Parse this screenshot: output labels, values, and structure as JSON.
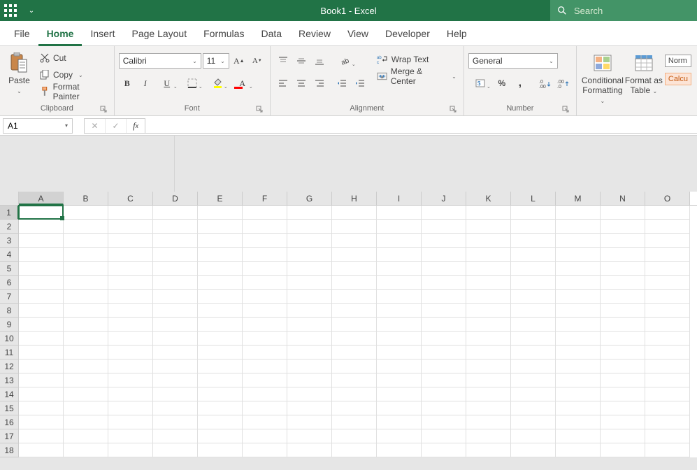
{
  "title": "Book1  -  Excel",
  "search_placeholder": "Search",
  "tabs": [
    "File",
    "Home",
    "Insert",
    "Page Layout",
    "Formulas",
    "Data",
    "Review",
    "View",
    "Developer",
    "Help"
  ],
  "active_tab": "Home",
  "clipboard": {
    "paste": "Paste",
    "cut": "Cut",
    "copy": "Copy",
    "format_painter": "Format Painter",
    "label": "Clipboard"
  },
  "font": {
    "name": "Calibri",
    "size": "11",
    "label": "Font"
  },
  "alignment": {
    "wrap": "Wrap Text",
    "merge": "Merge & Center",
    "label": "Alignment"
  },
  "number": {
    "format": "General",
    "label": "Number"
  },
  "styles": {
    "cond": "Conditional Formatting",
    "fat": "Format as Table",
    "normal": "Norm",
    "calc": "Calcu"
  },
  "name_box": "A1",
  "cols": [
    "A",
    "B",
    "C",
    "D",
    "E",
    "F",
    "G",
    "H",
    "I",
    "J",
    "K",
    "L",
    "M",
    "N",
    "O"
  ],
  "rows": [
    "1",
    "2",
    "3",
    "4",
    "5",
    "6",
    "7",
    "8",
    "9",
    "10",
    "11",
    "12",
    "13",
    "14",
    "15",
    "16",
    "17",
    "18"
  ]
}
